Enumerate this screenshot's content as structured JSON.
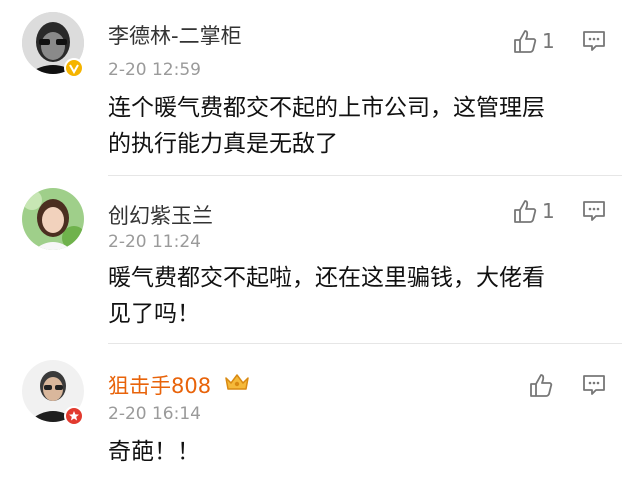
{
  "comments": [
    {
      "author": "李德林-二掌柜",
      "time": "2-20 12:59",
      "likes": "1",
      "text_lines": [
        "连个暖气费都交不起的上市公司，这管理层",
        "的执行能力真是无敌了"
      ],
      "badge": "v-verified-icon",
      "badge_color": "#f5b400"
    },
    {
      "author": "创幻紫玉兰",
      "time": "2-20 11:24",
      "likes": "1",
      "text_lines": [
        "暖气费都交不起啦，还在这里骗钱，大佬看",
        "见了吗！"
      ]
    },
    {
      "author": "狙击手808",
      "time": "2-20 16:14",
      "likes": "",
      "text_lines": [
        "奇葩！！"
      ],
      "badge": "star-icon",
      "badge_color": "#e23a2e",
      "vip_icon": "crown-icon",
      "name_color": "#e8630a"
    }
  ]
}
